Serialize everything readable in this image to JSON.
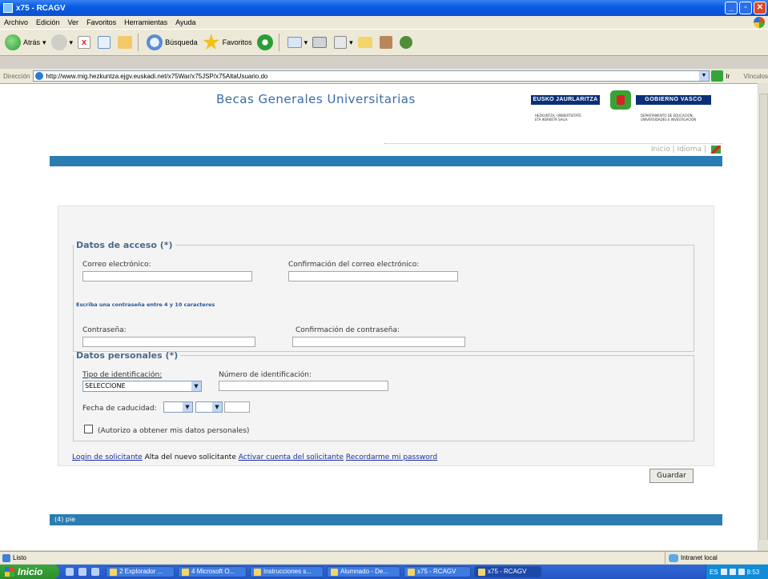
{
  "window": {
    "title": "x75 - RCAGV"
  },
  "menu": [
    "Archivo",
    "Edición",
    "Ver",
    "Favoritos",
    "Herramientas",
    "Ayuda"
  ],
  "toolbar": {
    "back_label": "Atrás",
    "search_label": "Búsqueda",
    "favorites_label": "Favoritos"
  },
  "address": {
    "label": "Dirección",
    "url": "http://www.mig.hezkuntza.ejgv.euskadi.net/x75War/x75JSP/x75AltaUsuario.do",
    "go_label": "Ir",
    "links_label": "Vínculos"
  },
  "page": {
    "title": "Becas Generales Universitarias",
    "logo_left": "EUSKO JAURLARITZA",
    "logo_right": "GOBIERNO VASCO",
    "logo_left_sub": "HEZKUNTZA, UNIBERTSITATE ETA IKERKETA SAILA",
    "logo_right_sub": "DEPARTAMENTO DE EDUCACIÓN, UNIVERSIDADES E INVESTIGACIÓN",
    "top_links": "Inicio | Idioma |",
    "access": {
      "legend": "Datos de acceso (*)",
      "email_label": "Correo electrónico:",
      "email_confirm_label": "Confirmación del correo electrónico:",
      "password_hint": "Escriba una contraseña entre 4 y 10 caracteres",
      "password_label": "Contraseña:",
      "password_confirm_label": "Confirmación de contraseña:"
    },
    "personal": {
      "legend": "Datos personales (*)",
      "id_type_label": "Tipo de identificación:",
      "id_type_value": "SELECCIONE",
      "id_number_label": "Número de identificación:",
      "expiry_label": "Fecha de caducidad:",
      "consent_label": "(Autorizo a obtener mis datos personales)"
    },
    "links": {
      "login": "Login de solicitante",
      "new": "Alta del nuevo solicitante",
      "activate": "Activar cuenta del solicitante",
      "remember": "Recordarme mi password"
    },
    "save_button": "Guardar",
    "footer": "(4) pie"
  },
  "status": {
    "text": "Listo",
    "zone": "Intranet local"
  },
  "taskbar": {
    "start": "Inicio",
    "tasks": [
      "2 Explorador ...",
      "4 Microsoft O...",
      "Instrucciones s...",
      "Alumnado - De...",
      "x75 - RCAGV",
      "x75 - RCAGV"
    ],
    "lang": "ES",
    "clock": "8:53"
  }
}
